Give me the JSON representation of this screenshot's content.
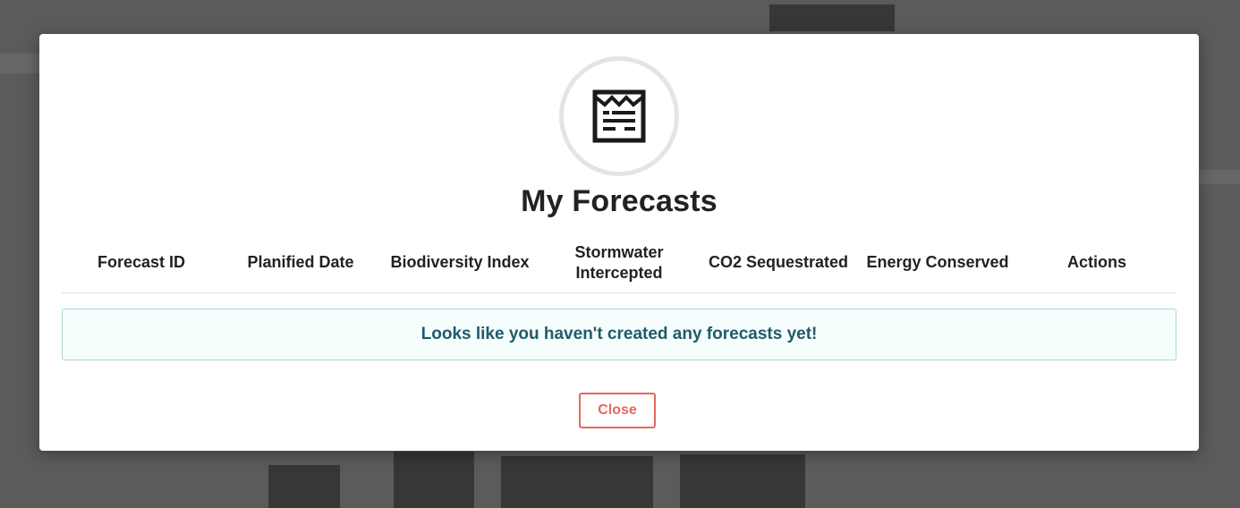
{
  "modal": {
    "title": "My Forecasts",
    "icon": "forecast-document-icon",
    "columns": [
      "Forecast ID",
      "Planified Date",
      "Biodiversity Index",
      "Stormwater\nIntercepted",
      "CO2 Sequestrated",
      "Energy Conserved",
      "Actions"
    ],
    "empty_message": "Looks like you haven't created any forecasts yet!",
    "close_label": "Close"
  },
  "colors": {
    "close_accent": "#e8675a",
    "empty_bg": "#f6fdfd",
    "empty_border": "#a9d6d6",
    "empty_text": "#1f5b6b"
  }
}
